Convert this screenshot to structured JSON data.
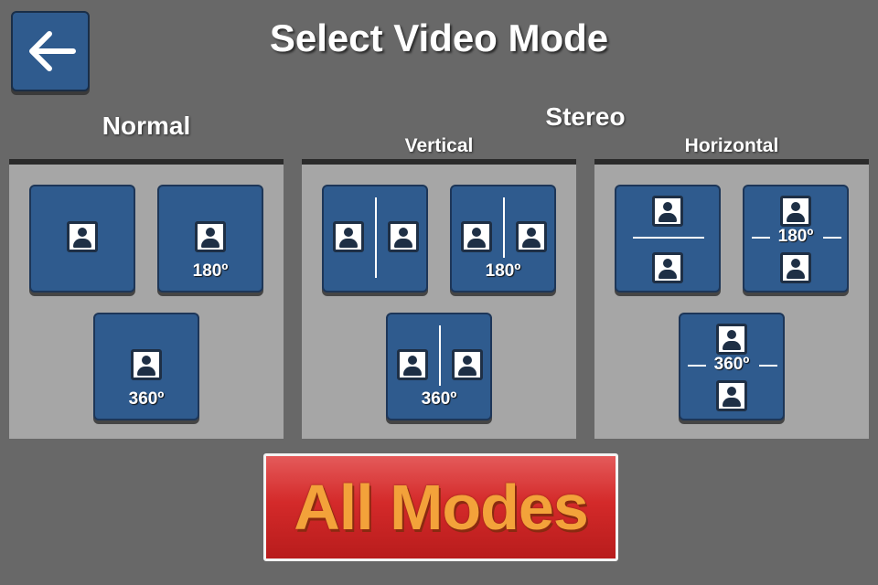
{
  "header": {
    "title": "Select Video Mode",
    "back_icon": "arrow-left-icon"
  },
  "sections": {
    "normal": "Normal",
    "stereo": "Stereo",
    "vertical": "Vertical",
    "horizontal": "Horizontal"
  },
  "modes": {
    "normal_180": "180º",
    "normal_360": "360º",
    "vertical_180": "180º",
    "vertical_360": "360º",
    "horizontal_180": "180º",
    "horizontal_360": "360º"
  },
  "footer": {
    "all_modes_label": "All Modes"
  },
  "colors": {
    "background": "#686868",
    "panel": "#a6a6a6",
    "mode_button": "#2f5b8e",
    "all_modes_button": "#d42a2a",
    "all_modes_text": "#f3a23a"
  }
}
